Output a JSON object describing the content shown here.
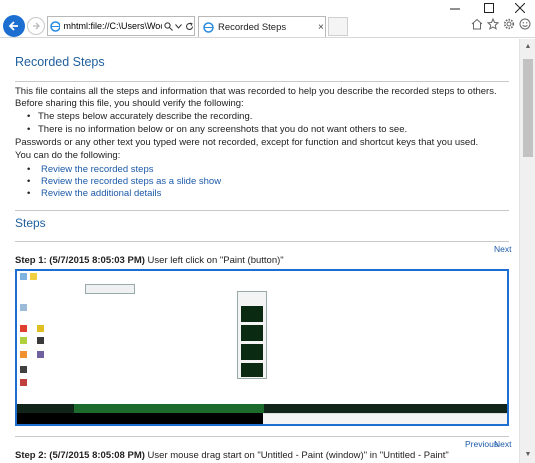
{
  "browser": {
    "address": "mhtml:file://C:\\Users\\Wood",
    "tab_title": "Recorded Steps",
    "tab_close": "×"
  },
  "page": {
    "title": "Recorded Steps",
    "intro_1": "This file contains all the steps and information that was recorded to help you describe the recorded steps to others.",
    "intro_2": "Before sharing this file, you should verify the following:",
    "verify_items": [
      "The steps below accurately describe the recording.",
      "There is no information below or on any screenshots that you do not want others to see."
    ],
    "note": "Passwords or any other text you typed were not recorded, except for function and shortcut keys that you used.",
    "can_do": "You can do the following:",
    "links": [
      "Review the recorded steps",
      "Review the recorded steps as a slide show",
      "Review the additional details"
    ],
    "steps_heading": "Steps",
    "next_label": "Next",
    "previous_label": "Previous",
    "step1_bold": "Step 1: (5/7/2015 8:05:03 PM)",
    "step1_text": " User left click on \"Paint (button)\"",
    "step2_bold": "Step 2: (5/7/2015 8:05:08 PM)",
    "step2_text": " User mouse drag start on \"Untitled - Paint (window)\" in \"Untitled - Paint\""
  },
  "colors": {
    "heading": "#1f5f9e",
    "link": "#1c5aa8",
    "accent": "#1c6fd1"
  }
}
